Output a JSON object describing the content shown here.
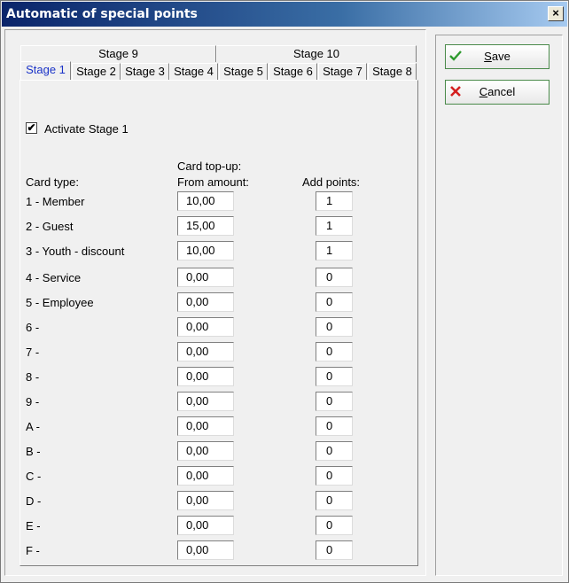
{
  "window": {
    "title": "Automatic of special points",
    "close": "×"
  },
  "tabs_row_top": [
    "Stage 9",
    "Stage 10"
  ],
  "tabs_row_bottom": [
    "Stage 1",
    "Stage 2",
    "Stage 3",
    "Stage 4",
    "Stage 5",
    "Stage 6",
    "Stage 7",
    "Stage 8"
  ],
  "activate": {
    "label": "Activate Stage 1",
    "checked": true,
    "mark": "✔"
  },
  "headers": {
    "card_type": "Card type:",
    "topup_line1": "Card top-up:",
    "topup_line2": "From amount:",
    "add_points": "Add points:"
  },
  "rows": [
    {
      "card": "1 - Member",
      "amount": "10,00",
      "points": "1"
    },
    {
      "card": "2 - Guest",
      "amount": "15,00",
      "points": "1"
    },
    {
      "card": "3 - Youth - discount",
      "amount": "10,00",
      "points": "1"
    },
    {
      "card": "4 - Service",
      "amount": "0,00",
      "points": "0"
    },
    {
      "card": "5 - Employee",
      "amount": "0,00",
      "points": "0"
    },
    {
      "card": "6 -",
      "amount": "0,00",
      "points": "0"
    },
    {
      "card": "7 -",
      "amount": "0,00",
      "points": "0"
    },
    {
      "card": "8 -",
      "amount": "0,00",
      "points": "0"
    },
    {
      "card": "9 -",
      "amount": "0,00",
      "points": "0"
    },
    {
      "card": "A -",
      "amount": "0,00",
      "points": "0"
    },
    {
      "card": "B -",
      "amount": "0,00",
      "points": "0"
    },
    {
      "card": "C -",
      "amount": "0,00",
      "points": "0"
    },
    {
      "card": "D -",
      "amount": "0,00",
      "points": "0"
    },
    {
      "card": "E -",
      "amount": "0,00",
      "points": "0"
    },
    {
      "card": "F -",
      "amount": "0,00",
      "points": "0"
    }
  ],
  "buttons": {
    "save": {
      "first": "S",
      "rest": "ave",
      "icon": "checkmark-icon"
    },
    "cancel": {
      "first": "C",
      "rest": "ancel",
      "icon": "cross-icon"
    }
  },
  "colors": {
    "active_tab_text": "#1a33c8",
    "save_icon": "#2e9a2e",
    "cancel_icon": "#d42020"
  }
}
